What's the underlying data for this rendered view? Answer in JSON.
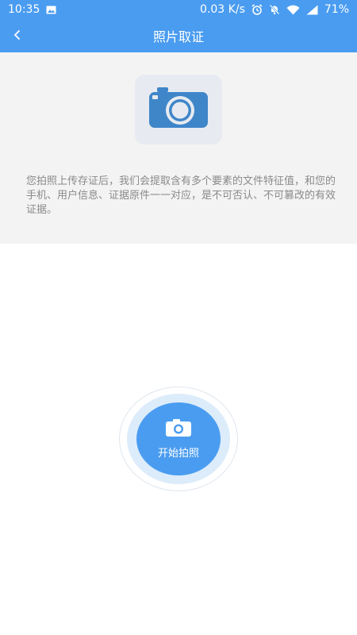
{
  "status_bar": {
    "time": "10:35",
    "network_speed": "0.03 K/s",
    "battery": "71%",
    "icons": [
      "image-icon",
      "alarm-icon",
      "notifications-off-icon",
      "wifi-icon",
      "signal-icon"
    ]
  },
  "nav": {
    "title": "照片取证",
    "back_icon": "chevron-left-icon"
  },
  "info": {
    "icon": "camera-icon",
    "text": "您拍照上传存证后，我们会提取含有多个要素的文件特征值，和您的手机、用户信息、证据原件一一对应，是不可否认、不可篡改的有效证据。"
  },
  "action": {
    "icon": "camera-icon",
    "label": "开始拍照"
  },
  "colors": {
    "primary": "#4a9cf0",
    "panel_bg": "#f3f3f3",
    "badge_bg": "#e7ebf1",
    "camera_icon": "#3f86c9",
    "text_muted": "#8a8a8a",
    "ring_light": "#dcecfb"
  }
}
